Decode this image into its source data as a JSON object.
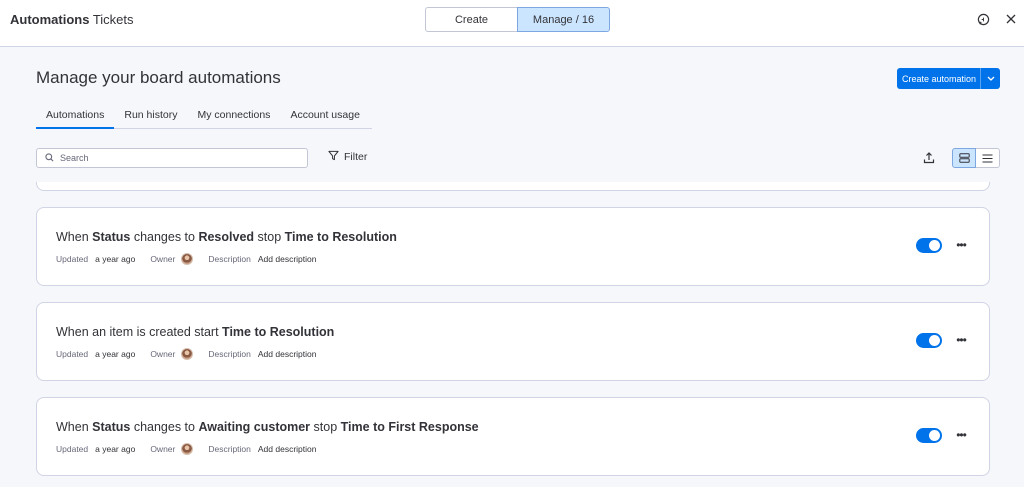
{
  "header": {
    "title_bold": "Automations",
    "title_rest": " Tickets",
    "segments": {
      "create": "Create",
      "manage": "Manage / 16"
    },
    "icons": [
      "feedback-icon",
      "close-icon"
    ]
  },
  "page": {
    "title": "Manage your board automations",
    "create_button": "Create automation",
    "tabs": [
      "Automations",
      "Run history",
      "My connections",
      "Account usage"
    ],
    "search_placeholder": "Search",
    "filter_label": "Filter"
  },
  "automations": [
    {
      "parts": [
        {
          "text": "When ",
          "bold": false
        },
        {
          "text": "Status",
          "bold": true
        },
        {
          "text": " changes to ",
          "bold": false
        },
        {
          "text": "Resolved",
          "bold": true
        },
        {
          "text": " stop ",
          "bold": false
        },
        {
          "text": "Time to Resolution",
          "bold": true
        }
      ],
      "updated_label": "Updated",
      "updated_value": "a year ago",
      "owner_label": "Owner",
      "description_label": "Description",
      "description_value": "Add description",
      "enabled": true
    },
    {
      "parts": [
        {
          "text": "When an item is created start ",
          "bold": false
        },
        {
          "text": "Time to Resolution",
          "bold": true
        }
      ],
      "updated_label": "Updated",
      "updated_value": "a year ago",
      "owner_label": "Owner",
      "description_label": "Description",
      "description_value": "Add description",
      "enabled": true
    },
    {
      "parts": [
        {
          "text": "When ",
          "bold": false
        },
        {
          "text": "Status",
          "bold": true
        },
        {
          "text": " changes to ",
          "bold": false
        },
        {
          "text": "Awaiting customer",
          "bold": true
        },
        {
          "text": " stop ",
          "bold": false
        },
        {
          "text": "Time to First Response",
          "bold": true
        }
      ],
      "updated_label": "Updated",
      "updated_value": "a year ago",
      "owner_label": "Owner",
      "description_label": "Description",
      "description_value": "Add description",
      "enabled": true
    }
  ],
  "colors": {
    "accent": "#0073ea",
    "selected_bg": "#cce5ff",
    "page_bg": "#f6f7fb"
  }
}
